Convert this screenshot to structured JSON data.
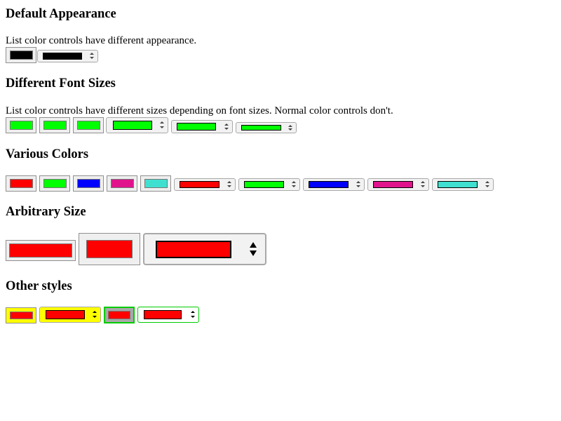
{
  "sections": {
    "default": {
      "heading": "Default Appearance",
      "desc": "List color controls have different appearance.",
      "color": "#000000"
    },
    "font_sizes": {
      "heading": "Different Font Sizes",
      "desc": "List color controls have different sizes depending on font sizes. Normal color controls don't.",
      "color": "#00ff00"
    },
    "various": {
      "heading": "Various Colors",
      "colors": [
        "#ff0000",
        "#00ff00",
        "#0000ff",
        "#e0138c",
        "#40e0d0"
      ]
    },
    "arbitrary": {
      "heading": "Arbitrary Size",
      "color": "#ff0000"
    },
    "other": {
      "heading": "Other styles",
      "color": "#ff0000",
      "yellow_bg": "#ffff00",
      "green_border": "#00cc00"
    }
  }
}
